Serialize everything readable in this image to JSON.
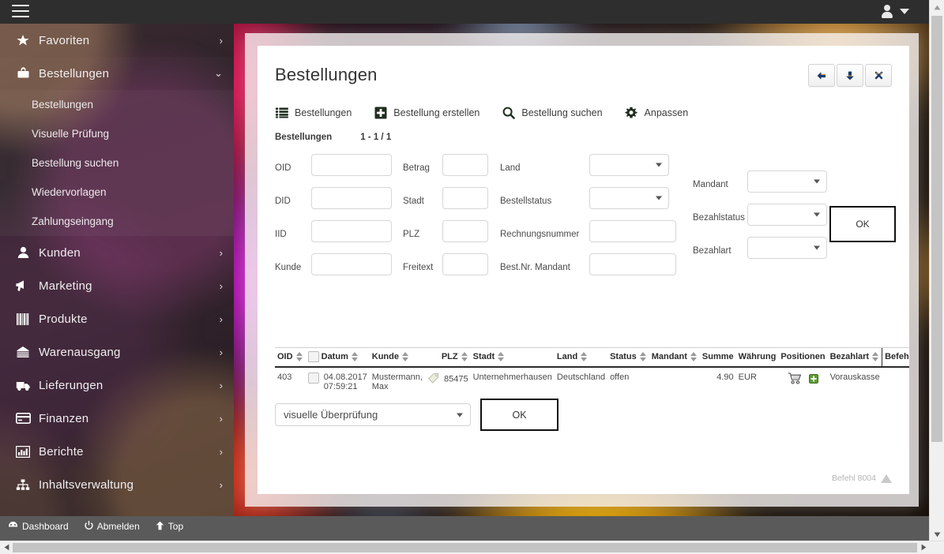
{
  "topbar": {
    "menu_icon": "hamburger-icon",
    "user_icon": "user-avatar-icon",
    "caret_icon": "chevron-down-icon"
  },
  "sidebar": {
    "items": [
      {
        "label": "Favoriten",
        "icon": "star-icon",
        "chevron": "›",
        "expanded": false
      },
      {
        "label": "Bestellungen",
        "icon": "briefcase-icon",
        "chevron": "⌄",
        "expanded": true
      },
      {
        "label": "Kunden",
        "icon": "user-icon",
        "chevron": "›",
        "expanded": false
      },
      {
        "label": "Marketing",
        "icon": "megaphone-icon",
        "chevron": "›",
        "expanded": false
      },
      {
        "label": "Produkte",
        "icon": "barcode-icon",
        "chevron": "›",
        "expanded": false
      },
      {
        "label": "Warenausgang",
        "icon": "warehouse-icon",
        "chevron": "›",
        "expanded": false
      },
      {
        "label": "Lieferungen",
        "icon": "truck-icon",
        "chevron": "›",
        "expanded": false
      },
      {
        "label": "Finanzen",
        "icon": "creditcard-icon",
        "chevron": "›",
        "expanded": false
      },
      {
        "label": "Berichte",
        "icon": "barchart-icon",
        "chevron": "›",
        "expanded": false
      },
      {
        "label": "Inhaltsverwaltung",
        "icon": "sitemap-icon",
        "chevron": "›",
        "expanded": false
      }
    ],
    "submenu": [
      {
        "label": "Bestellungen"
      },
      {
        "label": "Visuelle Prüfung"
      },
      {
        "label": "Bestellung suchen"
      },
      {
        "label": "Wiedervorlagen"
      },
      {
        "label": "Zahlungseingang"
      }
    ],
    "footer": [
      {
        "label": "Dashboard",
        "icon": "dashboard-icon"
      },
      {
        "label": "Abmelden",
        "icon": "power-icon"
      },
      {
        "label": "Top",
        "icon": "arrow-up-icon"
      }
    ]
  },
  "panel": {
    "title": "Bestellungen",
    "window_buttons": [
      {
        "name": "back-button",
        "icon": "arrow-left-icon"
      },
      {
        "name": "down-button",
        "icon": "arrow-down-icon"
      },
      {
        "name": "close-button",
        "icon": "close-x-icon"
      }
    ],
    "toolbar": [
      {
        "label": "Bestellungen",
        "icon": "list-icon"
      },
      {
        "label": "Bestellung erstellen",
        "icon": "plus-square-icon"
      },
      {
        "label": "Bestellung suchen",
        "icon": "search-icon"
      },
      {
        "label": "Anpassen",
        "icon": "gear-icon"
      }
    ],
    "subheader": {
      "label": "Bestellungen",
      "count": "1 - 1 / 1"
    },
    "form": {
      "col1": [
        {
          "label": "OID",
          "value": ""
        },
        {
          "label": "DID",
          "value": ""
        },
        {
          "label": "IID",
          "value": ""
        },
        {
          "label": "Kunde",
          "value": ""
        }
      ],
      "col2": [
        {
          "label": "Betrag",
          "value": ""
        },
        {
          "label": "Stadt",
          "value": ""
        },
        {
          "label": "PLZ",
          "value": ""
        },
        {
          "label": "Freitext",
          "value": ""
        }
      ],
      "col3": [
        {
          "label": "Land",
          "value": "",
          "type": "select"
        },
        {
          "label": "Bestellstatus",
          "value": "",
          "type": "select"
        },
        {
          "label": "Rechnungsnummer",
          "value": "",
          "type": "input"
        },
        {
          "label": "Best.Nr. Mandant",
          "value": "",
          "type": "input"
        }
      ],
      "col4": [
        {
          "label": "Mandant",
          "value": "",
          "type": "select"
        },
        {
          "label": "Bezahlstatus",
          "value": "",
          "type": "select"
        },
        {
          "label": "Bezahlart",
          "value": "",
          "type": "select"
        }
      ],
      "ok_label": "OK"
    },
    "table": {
      "columns": [
        {
          "label": "OID",
          "sortable": true,
          "checkbox": false
        },
        {
          "label": "Datum",
          "sortable": true,
          "checkbox": true
        },
        {
          "label": "Kunde",
          "sortable": true,
          "checkbox": false
        },
        {
          "label": "PLZ",
          "sortable": true,
          "checkbox": false
        },
        {
          "label": "Stadt",
          "sortable": true,
          "checkbox": false
        },
        {
          "label": "Land",
          "sortable": true,
          "checkbox": false
        },
        {
          "label": "Status",
          "sortable": true,
          "checkbox": false
        },
        {
          "label": "Mandant",
          "sortable": true,
          "checkbox": false
        },
        {
          "label": "Summe",
          "sortable": false,
          "checkbox": false
        },
        {
          "label": "Währung",
          "sortable": false,
          "checkbox": false
        },
        {
          "label": "Positionen",
          "sortable": false,
          "checkbox": false
        },
        {
          "label": "Bezahlart",
          "sortable": true,
          "checkbox": false
        },
        {
          "label": "Befehl",
          "sortable": false,
          "checkbox": false
        }
      ],
      "rows": [
        {
          "oid": "403",
          "datum_line1": "04.08.2017",
          "datum_line2": "07:59:21",
          "kunde_line1": "Mustermann,",
          "kunde_line2": "Max",
          "plz": "85475",
          "stadt": "Unternehmerhausen",
          "land": "Deutschland",
          "status": "offen",
          "mandant": "",
          "summe": "4.90",
          "waehrung": "EUR",
          "positionen_icons": [
            "shopping-cart-icon",
            "add-green-icon"
          ],
          "bezahlart": "Vorauskasse",
          "befehl": ""
        }
      ]
    },
    "bottom": {
      "select_value": "visuelle Überprüfung",
      "ok_label": "OK"
    },
    "footer_note": "Befehl 8004"
  },
  "colors": {
    "topbar_bg": "#2e2e2e",
    "panel_bg": "#ffffff",
    "accent_green": "#4f9a29",
    "footer_strip": "#5a5a5a"
  }
}
